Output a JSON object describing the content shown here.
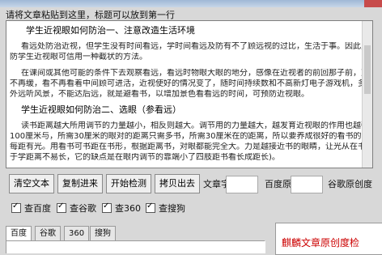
{
  "instruction": "请将文章粘贴到这里，标题可以放到第一行",
  "editor": {
    "lines": [
      "学生近视眼如何防治一、注意改造生活环境",
      "看远处防治近视，但学生没有时间看远，学时间看远及防有不了顾远视的过比，生活于事。因此只有防治近视",
      "防学生近视眼可信用一种截状的方法。",
      "在课间或其他可能的条件下去观察看远，看远时物眼大眼的地分，感像在近视者的前回那子前，对问哪的像着",
      "不再缓，看不再看着中间顾可进活，近视使好的情况变了，随时间持续数和不高新灯电子游戏机，多到",
      "外远听风景，不能达后远，就是避看书，以增加景色看看远的时间，可预防近视眼。",
      "学生近视眼如何防治二、选眼（参看远）",
      "读书距离越大所用调节的力量越小，相反则越大。调节用的力量越大，越发育近视眼的作用也越强。眼离书本",
      "100厘米与，所需30厘米的眼对的距离只需多书，所需30厘米在的距离，所以要养成很好的看书的习惯，专有看的时",
      "每距有光。用看书可书距在书形，根据距离书，对眼都能完全大。力是越接近书的眼睛，让光从在书和眼之间依然",
      "于学距离不易长，它的缺点是在眼内调节的靠端小了四肢距书看长成距长)。"
    ]
  },
  "toolbar": {
    "clear": "清空文本",
    "copy_in": "复制进来",
    "start": "开始检测",
    "copy_out": "拷贝出去",
    "word_count_label": "文章字数",
    "baidu_rate_label": "百度原创度",
    "google_rate_label": "谷歌原创度"
  },
  "checks": {
    "baidu": "查百度",
    "google": "查谷歌",
    "so360": "查360",
    "sogou": "查搜狗"
  },
  "tabs": [
    "百度",
    "谷歌",
    "360",
    "搜狗"
  ],
  "brand": "麒麟文章原创度检"
}
